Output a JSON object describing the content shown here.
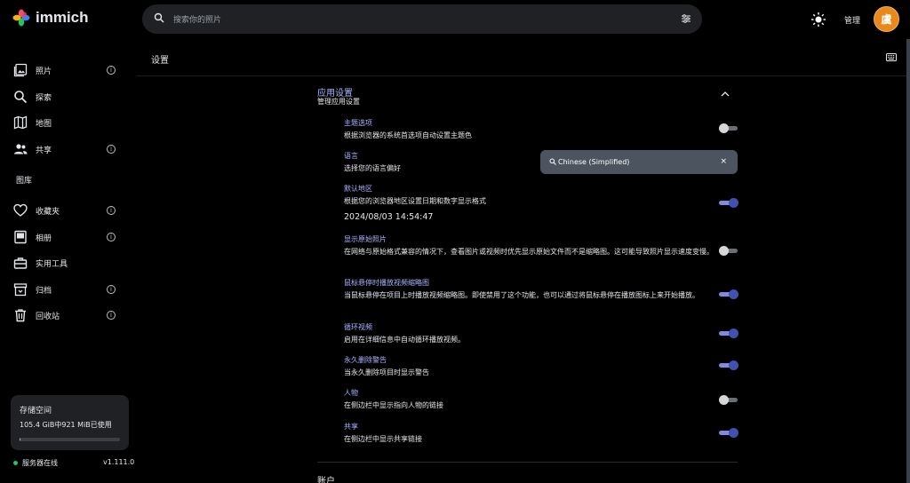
{
  "app": {
    "name": "immich"
  },
  "search": {
    "placeholder": "搜索你的照片"
  },
  "header": {
    "admin_label": "管理",
    "avatar_initial": "虞"
  },
  "sidebar": {
    "items": [
      {
        "label": "照片",
        "icon": "photos-icon",
        "info": true
      },
      {
        "label": "探索",
        "icon": "search-icon",
        "info": false
      },
      {
        "label": "地图",
        "icon": "map-icon",
        "info": false
      },
      {
        "label": "共享",
        "icon": "people-icon",
        "info": true
      }
    ],
    "library_label": "图库",
    "library_items": [
      {
        "label": "收藏夹",
        "icon": "heart-icon",
        "info": true
      },
      {
        "label": "相册",
        "icon": "album-icon",
        "info": true
      },
      {
        "label": "实用工具",
        "icon": "toolbox-icon",
        "info": false
      },
      {
        "label": "归档",
        "icon": "archive-icon",
        "info": true
      },
      {
        "label": "回收站",
        "icon": "trash-icon",
        "info": true
      }
    ],
    "storage": {
      "title": "存储空间",
      "usage": "105.4 GiB中921 MiB已使用",
      "used_fraction": 0.01
    },
    "server_status": "服务器在线",
    "version": "v1.111.0"
  },
  "main": {
    "title": "设置",
    "section_title": "应用设置",
    "section_subtitle": "管理应用设置",
    "settings": [
      {
        "title": "主题选项",
        "desc": "根据浏览器的系统首选项自动设置主题色",
        "toggle": "off"
      },
      {
        "title": "语言",
        "desc": "选择您的语言偏好",
        "toggle": null
      },
      {
        "title": "默认地区",
        "desc": "根据您的浏览器地区设置日期和数字显示格式",
        "toggle": "on",
        "extra": "2024/08/03 14:54:47"
      },
      {
        "title": "显示原始照片",
        "desc": "在网络与原始格式兼容的情况下，查看图片或视频时优先显示原始文件而不是缩略图。这可能导致照片显示速度变慢。",
        "toggle": "off"
      },
      {
        "title": "鼠标悬停时播放视频缩略图",
        "desc": "当鼠标悬停在项目上时播放视频缩略图。即使禁用了这个功能，也可以通过将鼠标悬停在播放图标上来开始播放。",
        "toggle": "on"
      },
      {
        "title": "循环视频",
        "desc": "启用在详细信息中自动循环播放视频。",
        "toggle": "on"
      },
      {
        "title": "永久删除警告",
        "desc": "当永久删除项目时显示警告",
        "toggle": "on"
      },
      {
        "title": "人物",
        "desc": "在侧边栏中显示指向人物的链接",
        "toggle": "off"
      },
      {
        "title": "共享",
        "desc": "在侧边栏中显示共享链接",
        "toggle": "on"
      }
    ],
    "language_select": {
      "value": "Chinese (Simplified)",
      "clear": "×"
    },
    "next_section_title": "账户"
  },
  "colors": {
    "accent": "#aab4ff",
    "toggle_on": "#4250af",
    "avatar": "#e8891a",
    "status_online": "#22c55e"
  }
}
